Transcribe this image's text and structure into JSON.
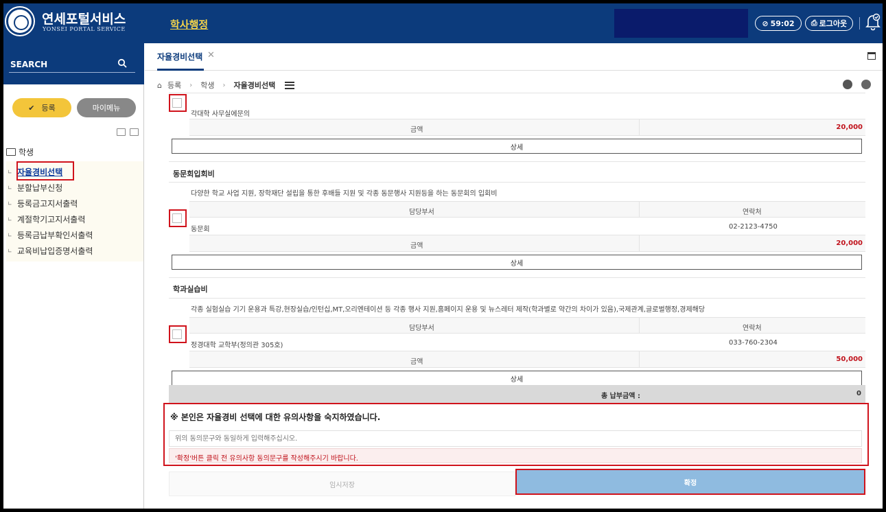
{
  "header": {
    "app_title": "연세포털서비스",
    "app_subtitle": "YONSEI PORTAL SERVICE",
    "menu_title": "학사행정",
    "timer": "59:02",
    "logout": "로그아웃"
  },
  "sidebar": {
    "search_label": "SEARCH",
    "btn_register": "등록",
    "btn_mymenu": "마이메뉴",
    "tree_root": "학생",
    "items": [
      {
        "label": "자율경비선택",
        "active": true
      },
      {
        "label": "분할납부신청",
        "active": false
      },
      {
        "label": "등록금고지서출력",
        "active": false
      },
      {
        "label": "계절학기고지서출력",
        "active": false
      },
      {
        "label": "등록금납부확인서출력",
        "active": false
      },
      {
        "label": "교육비납입증명서출력",
        "active": false
      }
    ]
  },
  "main": {
    "tab_label": "자율경비선택",
    "breadcrumb": [
      "등록",
      "학생",
      "자율경비선택"
    ],
    "top_section": {
      "dept": "각대학 사무실에문의",
      "amount_label": "금액",
      "amount": "20,000",
      "detail_label": "상세"
    },
    "sections": [
      {
        "title": "동문회입회비",
        "description": "다양한 학교 사업 지원, 장학재단 설립을 통한 후배들 지원 및 각종 동문행사 지원등을 하는 동문회의 입회비",
        "dept_header": "담당부서",
        "contact_header": "연락처",
        "dept": "동문회",
        "contact": "02-2123-4750",
        "amount_label": "금액",
        "amount": "20,000",
        "detail_label": "상세"
      },
      {
        "title": "학과실습비",
        "description": "각종 실험실습 기기 운용과 특강,현장실습/인턴십,MT,오리엔테이션 등 각종 행사 지원,홈페이지 운용 및 뉴스레터 제작(학과별로 약간의 차이가 있음),국제관계,글로벌행정,경제해당",
        "dept_header": "담당부서",
        "contact_header": "연락처",
        "dept": "정경대학 교학부(정의관 305호)",
        "contact": "033-760-2304",
        "amount_label": "금액",
        "amount": "50,000",
        "detail_label": "상세"
      }
    ],
    "total_label": "총 납부금액 :",
    "total_value": "0",
    "agree_title": "※ 본인은 자율경비 선택에 대한 유의사항을 숙지하였습니다.",
    "agree_placeholder": "위의 동의문구와 동일하게 입력해주십시오.",
    "agree_warning": "'확정'버튼 클릭 전 유의사항 동의문구를 작성해주시기 바랍니다.",
    "btn_temp": "임시저장",
    "btn_confirm": "확정"
  }
}
